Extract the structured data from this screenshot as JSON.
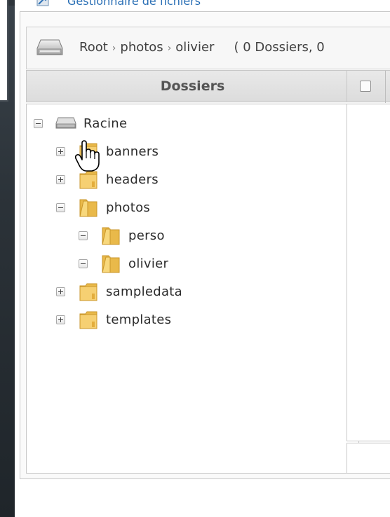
{
  "window": {
    "title": "Gestionnaire de fichiers"
  },
  "path_bar": {
    "crumbs": [
      "Root",
      "photos",
      "olivier"
    ],
    "separator": "›",
    "summary": "( 0 Dossiers, 0"
  },
  "folders_panel": {
    "header": "Dossiers",
    "tree": [
      {
        "label": "Racine",
        "icon": "drive-icon",
        "toggle": "minus",
        "depth": 0
      },
      {
        "label": "banners",
        "icon": "folder-icon",
        "toggle": "plus",
        "depth": 1
      },
      {
        "label": "headers",
        "icon": "folder-icon",
        "toggle": "plus",
        "depth": 1
      },
      {
        "label": "photos",
        "icon": "folder-open-icon",
        "toggle": "minus",
        "depth": 1
      },
      {
        "label": "perso",
        "icon": "folder-open-icon",
        "toggle": "minus",
        "depth": 2
      },
      {
        "label": "olivier",
        "icon": "folder-open-icon",
        "toggle": "minus",
        "depth": 2
      },
      {
        "label": "sampledata",
        "icon": "folder-icon",
        "toggle": "plus",
        "depth": 1
      },
      {
        "label": "templates",
        "icon": "folder-icon",
        "toggle": "plus",
        "depth": 1
      }
    ]
  },
  "files_panel": {
    "select_all_checked": false
  },
  "colors": {
    "title": "#2a6fb5",
    "folder": "#f2c34a",
    "header_bg": "#dcdcdc"
  }
}
